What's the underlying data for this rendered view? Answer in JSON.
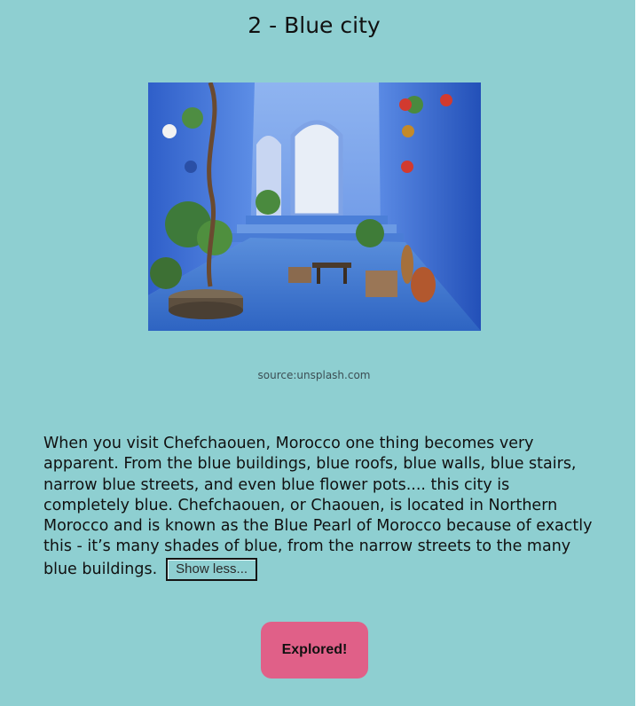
{
  "page": {
    "title": "2 - Blue city",
    "image_credit": "source:unsplash.com",
    "description": "When you visit Chefchaouen, Morocco one thing becomes very apparent. From the blue buildings, blue roofs, blue walls, blue stairs, narrow blue streets, and even blue flower pots.... this city is completely blue. Chefchaouen, or Chaouen, is located in Northern Morocco and is known as the Blue Pearl of Morocco because of exactly this - it’s many shades of blue, from the narrow streets to the many blue buildings.",
    "toggle_label": "Show less...",
    "explored_label": "Explored!"
  },
  "colors": {
    "background": "#8ecfd1",
    "explored_button": "#e06088",
    "photo_blue": "#3f6fd6"
  },
  "icons": {
    "photo": "chefchaouen-blue-courtyard-photo"
  }
}
